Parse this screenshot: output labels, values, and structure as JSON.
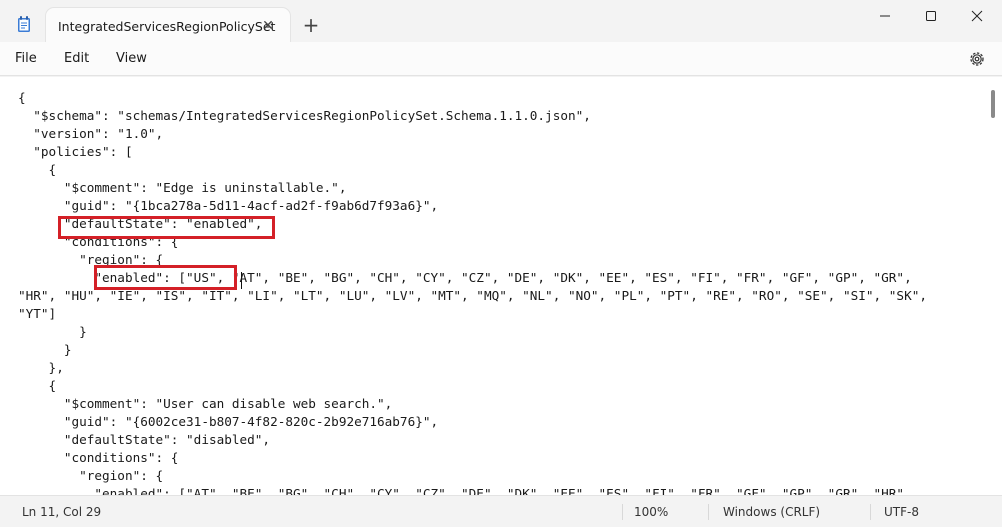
{
  "window": {
    "tab_title": "IntegratedServicesRegionPolicySet",
    "tab_close_glyph": "✕",
    "new_tab_glyph": "+"
  },
  "menu": {
    "file": "File",
    "edit": "Edit",
    "view": "View"
  },
  "editor": {
    "lines": [
      "{",
      "  \"$schema\": \"schemas/IntegratedServicesRegionPolicySet.Schema.1.1.0.json\",",
      "  \"version\": \"1.0\",",
      "  \"policies\": [",
      "    {",
      "      \"$comment\": \"Edge is uninstallable.\",",
      "      \"guid\": \"{1bca278a-5d11-4acf-ad2f-f9ab6d7f93a6}\",",
      "      \"defaultState\": \"enabled\",",
      "      \"conditions\": {",
      "        \"region\": {",
      "          \"enabled\": [\"US\", \"AT\", \"BE\", \"BG\", \"CH\", \"CY\", \"CZ\", \"DE\", \"DK\", \"EE\", \"ES\", \"FI\", \"FR\", \"GF\", \"GP\", \"GR\",",
      "\"HR\", \"HU\", \"IE\", \"IS\", \"IT\", \"LI\", \"LT\", \"LU\", \"LV\", \"MT\", \"MQ\", \"NL\", \"NO\", \"PL\", \"PT\", \"RE\", \"RO\", \"SE\", \"SI\", \"SK\",",
      "\"YT\"]",
      "        }",
      "      }",
      "    },",
      "    {",
      "      \"$comment\": \"User can disable web search.\",",
      "      \"guid\": \"{6002ce31-b807-4f82-820c-2b92e716ab76}\",",
      "      \"defaultState\": \"disabled\",",
      "      \"conditions\": {",
      "        \"region\": {",
      "          \"enabled\": [\"AT\", \"BE\", \"BG\", \"CH\", \"CY\", \"CZ\", \"DE\", \"DK\", \"EE\", \"ES\", \"FI\", \"FR\", \"GF\", \"GP\", \"GR\", \"HR\","
    ]
  },
  "status": {
    "position": "Ln 11, Col 29",
    "zoom": "100%",
    "line_ending": "Windows (CRLF)",
    "encoding": "UTF-8"
  },
  "colors": {
    "highlight": "#d42027",
    "text": "#1a1a1a"
  }
}
